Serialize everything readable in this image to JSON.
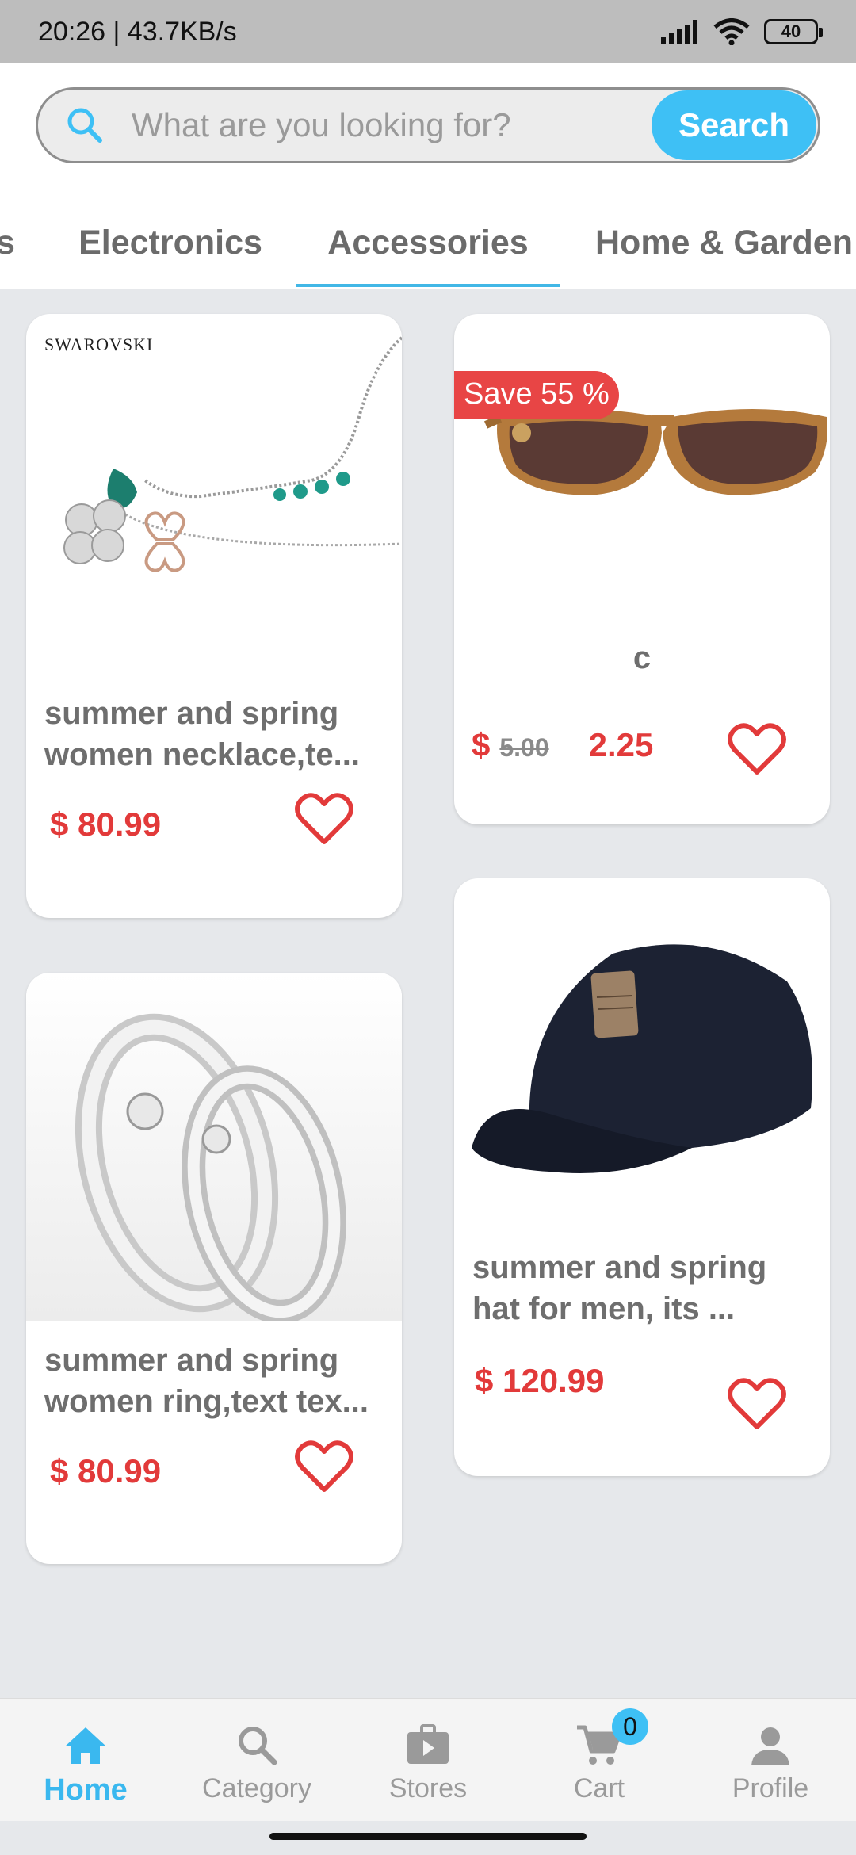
{
  "status_bar": {
    "time_speed": "20:26 | 43.7KB/s",
    "battery": "40"
  },
  "search": {
    "placeholder": "What are you looking for?",
    "button_label": "Search"
  },
  "tabs": [
    {
      "label": "s"
    },
    {
      "label": "Electronics"
    },
    {
      "label": "Accessories"
    },
    {
      "label": "Home & Garden"
    }
  ],
  "active_tab": "Accessories",
  "products": [
    {
      "brand": "SWAROVSKI",
      "title_line1": "summer and spring",
      "title_line2": "women necklace,te...",
      "price": "$ 80.99",
      "image": "necklace"
    },
    {
      "badge": "Save 55 %",
      "title": "c",
      "currency": "$",
      "old_price": "5.00",
      "price": "2.25",
      "image": "sunglasses"
    },
    {
      "title_line1": "summer and spring",
      "title_line2": "women ring,text tex...",
      "price": "$ 80.99",
      "image": "rings"
    },
    {
      "title_line1": "summer and spring",
      "title_line2": "hat for men, its ...",
      "price": "$ 120.99",
      "image": "cap"
    }
  ],
  "bottom_nav": {
    "items": [
      {
        "label": "Home",
        "icon": "home-icon"
      },
      {
        "label": "Category",
        "icon": "search-icon"
      },
      {
        "label": "Stores",
        "icon": "store-icon"
      },
      {
        "label": "Cart",
        "icon": "cart-icon"
      },
      {
        "label": "Profile",
        "icon": "person-icon"
      }
    ],
    "cart_count": "0",
    "active": "Home"
  },
  "colors": {
    "accent": "#3ec0f5",
    "price": "#e23a3a",
    "badge": "#e84545",
    "background": "#e6e8eb"
  }
}
